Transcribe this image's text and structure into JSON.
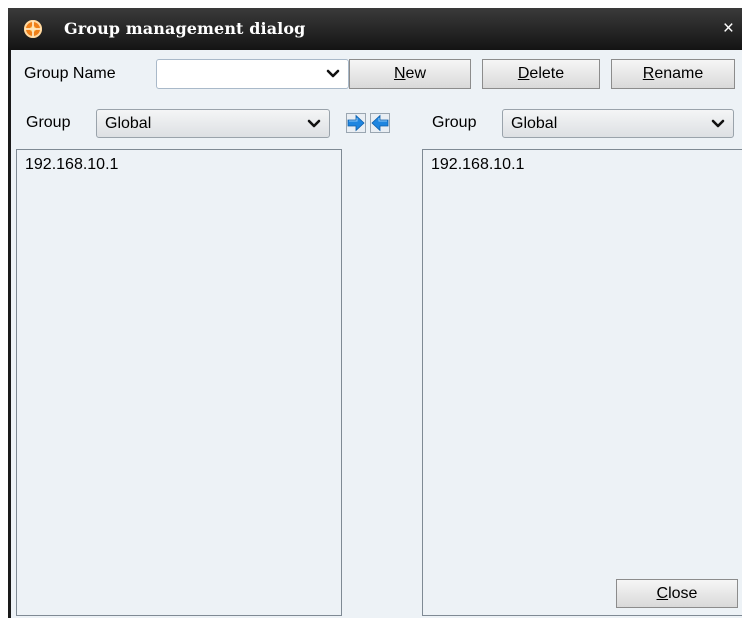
{
  "window": {
    "title": "Group management dialog",
    "close_glyph": "×",
    "app_icon": "orange-gear-icon"
  },
  "top_row": {
    "group_name_label": "Group Name",
    "group_name_value": "",
    "new_mnemonic": "N",
    "new_rest": "ew",
    "delete_mnemonic": "D",
    "delete_rest": "elete",
    "rename_mnemonic": "R",
    "rename_rest": "ename"
  },
  "left_panel": {
    "group_label": "Group",
    "group_value": "Global",
    "items": [
      "192.168.10.1"
    ]
  },
  "right_panel": {
    "group_label": "Group",
    "group_value": "Global",
    "items": [
      "192.168.10.1"
    ]
  },
  "transfer": {
    "move_right_icon": "arrow-right-icon",
    "move_left_icon": "arrow-left-icon"
  },
  "footer": {
    "close_mnemonic": "C",
    "close_rest": "lose"
  },
  "colors": {
    "dialog_bg": "#edf2f6",
    "titlebar": "#1f1f1f",
    "arrow_blue": "#1f86e0"
  }
}
